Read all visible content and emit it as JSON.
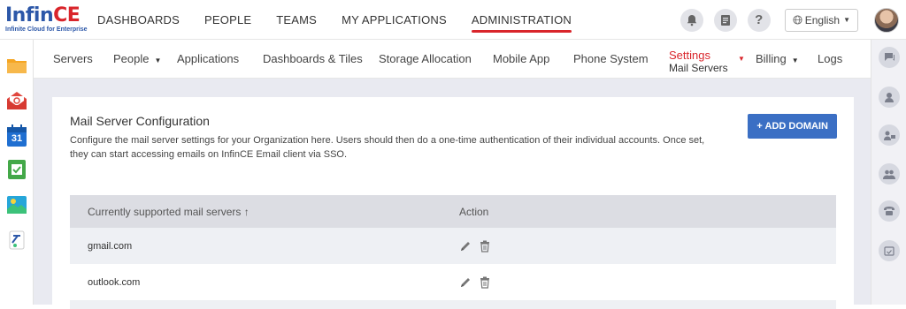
{
  "brand": {
    "name_part1": "Infin",
    "name_part2": "CE",
    "tagline": "Infinite Cloud for Enterprise"
  },
  "top_nav": [
    {
      "label": "DASHBOARDS",
      "active": false
    },
    {
      "label": "PEOPLE",
      "active": false
    },
    {
      "label": "TEAMS",
      "active": false
    },
    {
      "label": "MY APPLICATIONS",
      "active": false
    },
    {
      "label": "ADMINISTRATION",
      "active": true
    }
  ],
  "top_right": {
    "help_glyph": "?",
    "language": "English"
  },
  "sub_nav": {
    "servers": "Servers",
    "people": "People",
    "applications": "Applications",
    "dashboards_tiles": "Dashboards & Tiles",
    "storage": "Storage Allocation",
    "mobile": "Mobile App",
    "phone": "Phone System",
    "settings": "Settings",
    "settings_sub": "Mail Servers",
    "billing": "Billing",
    "logs": "Logs"
  },
  "page": {
    "title": "Mail Server Configuration",
    "description": "Configure the mail server settings for your Organization here. Users should then do a one-time authentication of their individual accounts. Once set, they can start accessing emails on InfinCE Email client via SSO.",
    "add_button": "+ ADD DOMAIN"
  },
  "table": {
    "headers": {
      "server": "Currently supported mail servers ↑",
      "action": "Action"
    },
    "rows": [
      {
        "server": "gmail.com"
      },
      {
        "server": "outlook.com"
      }
    ]
  },
  "left_apps": [
    "folder-icon",
    "mail-icon",
    "calendar-icon",
    "tasks-icon",
    "gallery-icon",
    "forms-icon"
  ],
  "calendar_day": "31",
  "right_rail": [
    "chat-icon",
    "person-icon",
    "contact-icon",
    "group-icon",
    "phone-icon",
    "calendar-check-icon"
  ],
  "colors": {
    "brand_blue": "#2c57a8",
    "brand_red": "#d9252b",
    "button_blue": "#3b6fc4"
  }
}
